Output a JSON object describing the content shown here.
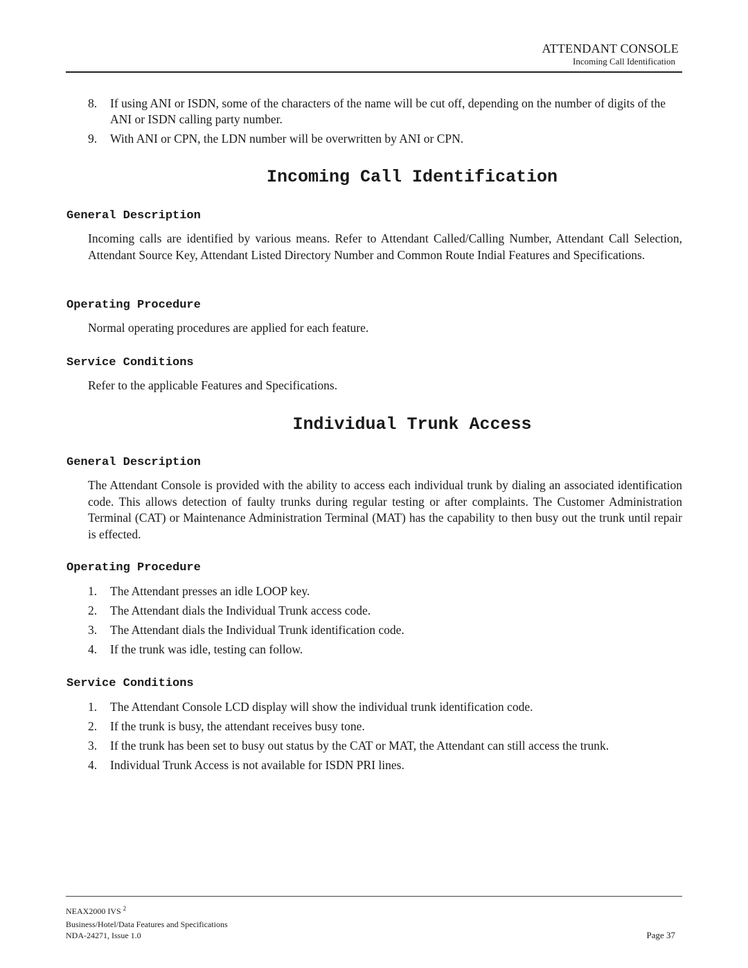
{
  "header": {
    "chapter": "ATTENDANT CONSOLE",
    "section": "Incoming Call Identification"
  },
  "continued_list": [
    {
      "num": "8.",
      "text": "If using ANI or ISDN, some of the characters of the name will be cut off, depending on the number of digits of the ANI or ISDN calling party number."
    },
    {
      "num": "9.",
      "text": "With ANI or CPN, the LDN number will be overwritten by ANI or CPN."
    }
  ],
  "sections": [
    {
      "title": "Incoming Call Identification",
      "general_description_heading": "General Description",
      "general_description": "Incoming calls are identified by various means. Refer to Attendant Called/Calling Number, Attendant Call Selection, Attendant Source Key, Attendant Listed Directory Number and Common Route Indial Features and Specifications.",
      "operating_procedure_heading": "Operating Procedure",
      "operating_procedure": "Normal operating procedures are applied for each feature.",
      "service_conditions_heading": "Service Conditions",
      "service_conditions": "Refer to the applicable Features and Specifications."
    },
    {
      "title": "Individual Trunk Access",
      "general_description_heading": "General Description",
      "general_description": "The Attendant Console is provided with the ability to access each individual trunk by dialing an associated identification code. This allows detection of faulty trunks during regular testing or after complaints. The Customer Administration Terminal (CAT) or Maintenance Administration Terminal (MAT) has the capability to then busy out the trunk until repair is effected.",
      "operating_procedure_heading": "Operating Procedure",
      "operating_procedure": [
        {
          "num": "1.",
          "text": "The Attendant presses an idle LOOP key."
        },
        {
          "num": "2.",
          "text": "The Attendant dials the Individual Trunk access code."
        },
        {
          "num": "3.",
          "text": "The Attendant dials the Individual Trunk identification code."
        },
        {
          "num": "4.",
          "text": "If the trunk was idle, testing can follow."
        }
      ],
      "service_conditions_heading": "Service Conditions",
      "service_conditions": [
        {
          "num": "1.",
          "text": "The Attendant Console LCD display will show the individual trunk identification code."
        },
        {
          "num": "2.",
          "text": "If the trunk is busy, the attendant receives busy tone."
        },
        {
          "num": "3.",
          "text": "If the trunk has been set to busy out status by the CAT or MAT, the Attendant can still access the trunk."
        },
        {
          "num": "4.",
          "text": "Individual Trunk Access is not available for ISDN PRI lines."
        }
      ]
    }
  ],
  "footer": {
    "product": "NEAX2000 IVS",
    "product_sup": "2",
    "doc_title": "Business/Hotel/Data Features and Specifications",
    "doc_id": "NDA-24271, Issue 1.0",
    "page": "Page 37"
  }
}
